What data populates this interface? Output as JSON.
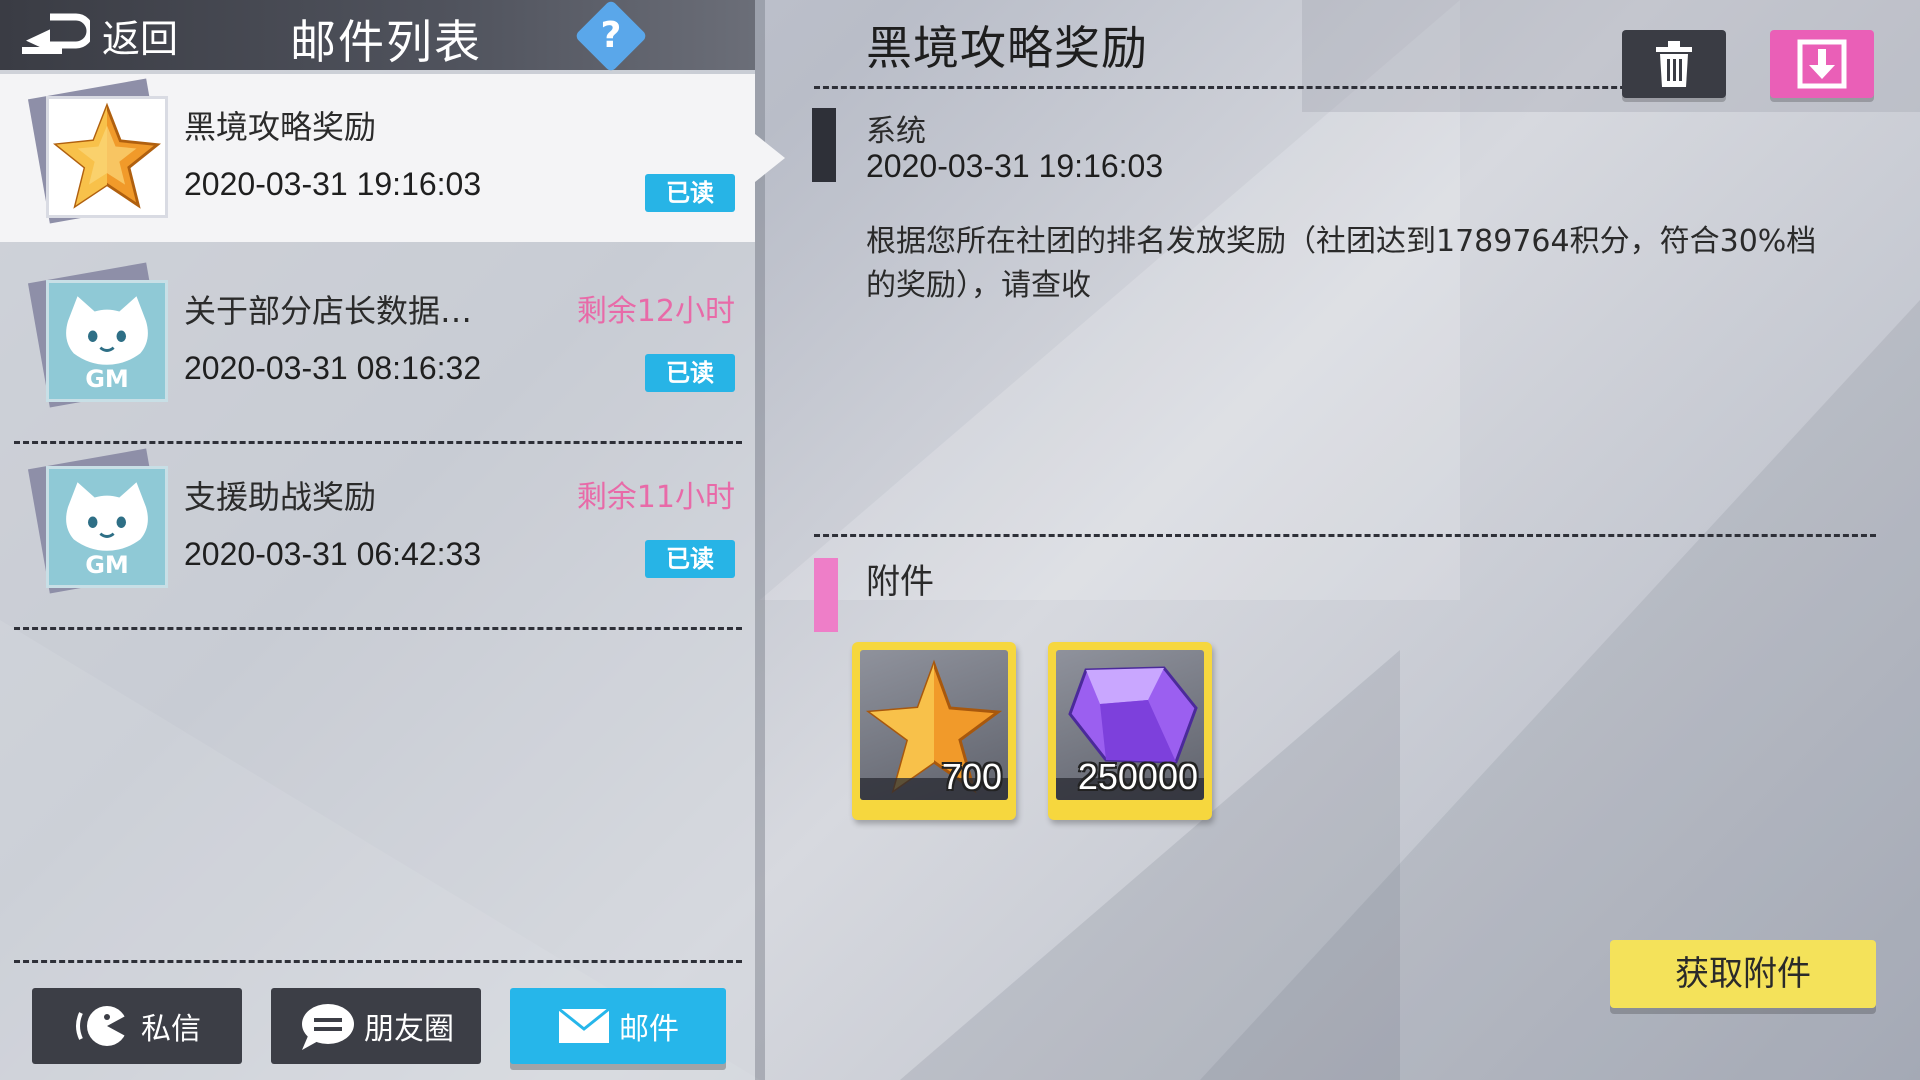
{
  "header": {
    "back_label": "返回",
    "title": "邮件列表",
    "help_symbol": "?"
  },
  "mail_list": [
    {
      "title": "黑境攻略奖励",
      "date": "2020-03-31 19:16:03",
      "remaining": "",
      "status": "已读",
      "avatar": "gold-star-icon",
      "selected": true
    },
    {
      "title": "关于部分店长数据…",
      "date": "2020-03-31 08:16:32",
      "remaining": "剩余12小时",
      "status": "已读",
      "avatar": "gm-cat-icon",
      "avatar_text": "GM"
    },
    {
      "title": "支援助战奖励",
      "date": "2020-03-31 06:42:33",
      "remaining": "剩余11小时",
      "status": "已读",
      "avatar": "gm-cat-icon",
      "avatar_text": "GM"
    }
  ],
  "tabs": {
    "messages": "私信",
    "moments": "朋友圈",
    "mail": "邮件"
  },
  "detail": {
    "title": "黑境攻略奖励",
    "sender": "系统",
    "date": "2020-03-31 19:16:03",
    "body": "根据您所在社团的排名发放奖励（社团达到1789764积分，符合30%档的奖励），请查收",
    "attachments_label": "附件",
    "attachments": [
      {
        "icon": "gold-star-icon",
        "quantity": "700"
      },
      {
        "icon": "purple-gem-icon",
        "quantity": "250000"
      }
    ],
    "claim_label": "获取附件"
  },
  "colors": {
    "accent_blue": "#27b4e6",
    "accent_pink": "#ea5fb7",
    "claim_yellow": "#f4e25a",
    "remaining_pink": "#e86aa8"
  }
}
